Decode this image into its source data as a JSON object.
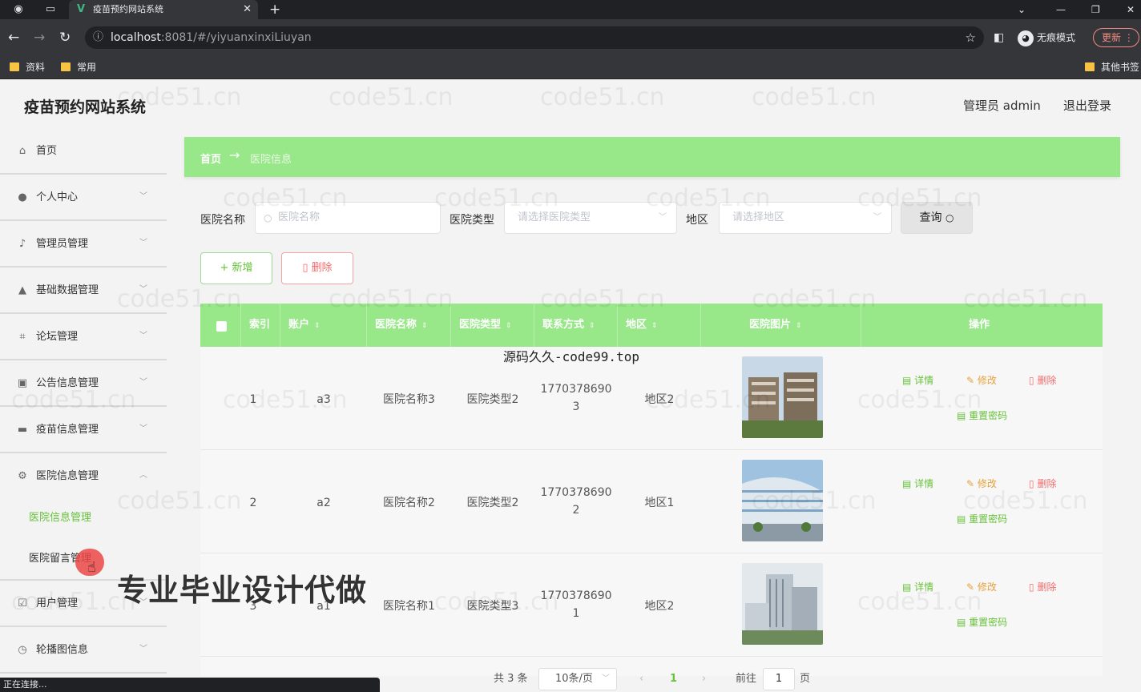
{
  "browser": {
    "tab_title": "疫苗预约网站系统",
    "url_host": "localhost",
    "url_rest": ":8081/#/yiyuanxinxiLiuyan",
    "incognito_label": "无痕模式",
    "update_label": "更新",
    "bookmarks": [
      "资料",
      "常用"
    ],
    "other_bookmarks": "其他书签",
    "status_text": "正在连接..."
  },
  "app": {
    "title": "疫苗预约网站系统",
    "user_label": "管理员 admin",
    "logout_label": "退出登录"
  },
  "sidebar": {
    "items": [
      {
        "label": "首页",
        "icon": "home-icon",
        "glyph": "⌂",
        "chevron": ""
      },
      {
        "label": "个人中心",
        "icon": "user-icon",
        "glyph": "●",
        "chevron": "﹀"
      },
      {
        "label": "管理员管理",
        "icon": "mic-icon",
        "glyph": "♪",
        "chevron": "﹀"
      },
      {
        "label": "基础数据管理",
        "icon": "person-icon",
        "glyph": "▲",
        "chevron": "﹀"
      },
      {
        "label": "论坛管理",
        "icon": "crop-icon",
        "glyph": "⌗",
        "chevron": "﹀"
      },
      {
        "label": "公告信息管理",
        "icon": "chart-icon",
        "glyph": "▣",
        "chevron": "﹀"
      },
      {
        "label": "疫苗信息管理",
        "icon": "monitor-icon",
        "glyph": "▬",
        "chevron": "﹀"
      },
      {
        "label": "医院信息管理",
        "icon": "settings-icon",
        "glyph": "⚙",
        "chevron": "︿"
      }
    ],
    "sub_items": [
      "医院信息管理",
      "医院留言管理"
    ],
    "bottom_items": [
      {
        "label": "用户管理",
        "icon": "check-icon",
        "glyph": "☑",
        "chevron": "﹀"
      },
      {
        "label": "轮播图信息",
        "icon": "clock-icon",
        "glyph": "◷",
        "chevron": "﹀"
      }
    ]
  },
  "breadcrumb": {
    "home": "首页",
    "separator": "→",
    "current": "医院信息"
  },
  "filters": {
    "name_label": "医院名称",
    "name_placeholder": "医院名称",
    "type_label": "医院类型",
    "type_placeholder": "请选择医院类型",
    "region_label": "地区",
    "region_placeholder": "请选择地区",
    "search_label": "查询"
  },
  "toolbar": {
    "add_label": "+ 新增",
    "delete_label": "删除"
  },
  "table": {
    "headers": [
      "索引",
      "账户",
      "医院名称",
      "医院类型",
      "联系方式",
      "地区",
      "医院图片",
      "操作"
    ],
    "rows": [
      {
        "index": "1",
        "account": "a3",
        "name": "医院名称3",
        "type": "医院类型2",
        "phone_1": "1770378690",
        "phone_2": "3",
        "region": "地区2"
      },
      {
        "index": "2",
        "account": "a2",
        "name": "医院名称2",
        "type": "医院类型2",
        "phone_1": "1770378690",
        "phone_2": "2",
        "region": "地区1"
      },
      {
        "index": "3",
        "account": "a1",
        "name": "医院名称1",
        "type": "医院类型3",
        "phone_1": "1770378690",
        "phone_2": "1",
        "region": "地区2"
      }
    ],
    "actions": {
      "detail": "详情",
      "edit": "修改",
      "delete": "删除",
      "reset": "重置密码"
    }
  },
  "pagination": {
    "total": "共 3 条",
    "page_size": "10条/页",
    "current_page": "1",
    "goto_label": "前往",
    "goto_value": "1",
    "page_suffix": "页"
  },
  "overlays": {
    "caption": "源码久久-code99.top",
    "ad": "专业毕业设计代做",
    "watermark": "code51.cn"
  },
  "colors": {
    "accent_green": "#98e88a",
    "success": "#67c23a",
    "warning": "#e6a23c",
    "danger": "#f56c6c"
  }
}
